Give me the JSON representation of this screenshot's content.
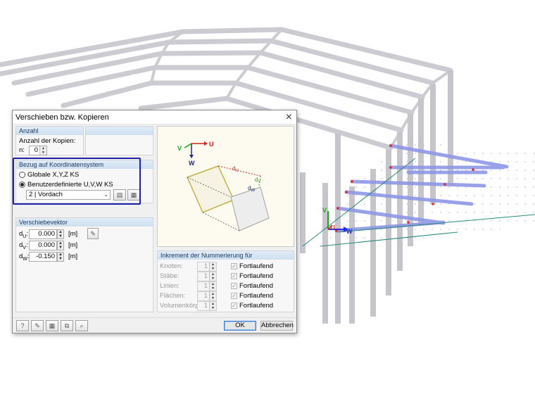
{
  "dialog": {
    "title": "Verschieben bzw. Kopieren",
    "close_glyph": "×",
    "anzahl": {
      "header": "Anzahl",
      "label": "Anzahl der Kopien:",
      "n_label": "n:",
      "n_value": "0"
    },
    "bezug": {
      "header": "Bezug auf Koordinatensystem",
      "option_global": "Globale X,Y,Z KS",
      "option_user": "Benutzerdefinierte U,V,W KS",
      "selected_option": "Benutzerdefinierte U,V,W KS",
      "system_value": "2 | Vordach",
      "highlight_color": "#1d22a8"
    },
    "vektor": {
      "header": "Verschiebevektor",
      "rows": [
        {
          "sym": "d",
          "sub": "U",
          "value": "0.000",
          "unit": "[m]"
        },
        {
          "sym": "d",
          "sub": "V",
          "value": "0.000",
          "unit": "[m]"
        },
        {
          "sym": "d",
          "sub": "W",
          "value": "-0.150",
          "unit": "[m]"
        }
      ]
    },
    "preview": {
      "axis_u": "U",
      "axis_v": "V",
      "axis_w": "W",
      "du": "d",
      "du_sub": "U",
      "dv": "d",
      "dv_sub": "V",
      "dw": "d",
      "dw_sub": "W"
    },
    "inkrement": {
      "header": "Inkrement der Nummerierung für",
      "rows": [
        {
          "label": "Knoten:",
          "value": "1",
          "check_label": "Fortlaufend"
        },
        {
          "label": "Stäbe:",
          "value": "1",
          "check_label": "Fortlaufend"
        },
        {
          "label": "Linien:",
          "value": "1",
          "check_label": "Fortlaufend"
        },
        {
          "label": "Flächen:",
          "value": "1",
          "check_label": "Fortlaufend"
        },
        {
          "label": "Volumenkörper:",
          "value": "1",
          "check_label": "Fortlaufend"
        }
      ]
    },
    "buttons": {
      "ok": "OK",
      "cancel": "Abbrechen"
    },
    "toolbar_icons": [
      "help-icon",
      "edit-icon",
      "units-icon",
      "copy-icon",
      "search-icon"
    ]
  },
  "model": {
    "axis_labels": {
      "u": "U",
      "v": "V",
      "w": "W"
    },
    "colors": {
      "frame": "#c9c9cf",
      "purlin": "#9aa2e8",
      "axis_red": "#e02a2a",
      "axis_blue": "#2a2adf",
      "axis_green": "#1aa31a"
    }
  }
}
